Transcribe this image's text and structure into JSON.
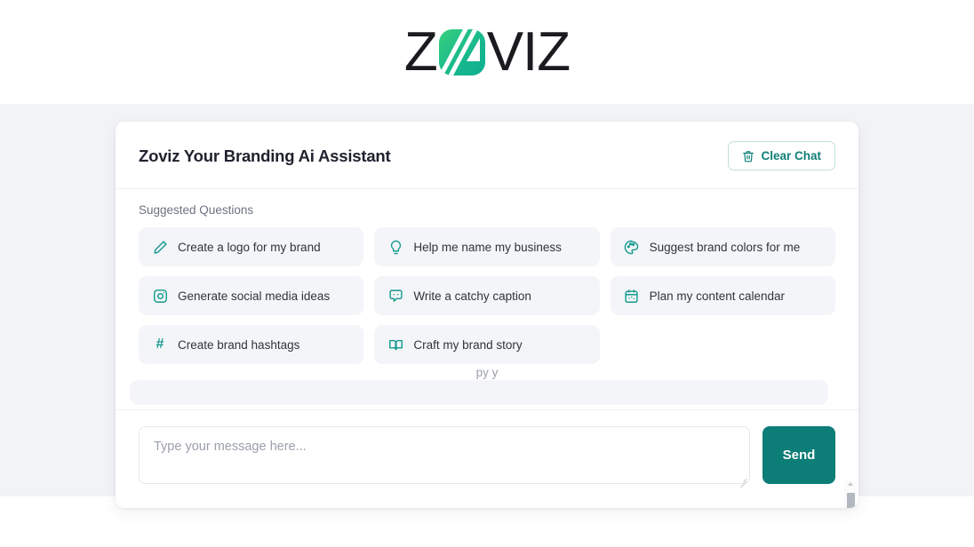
{
  "brand": {
    "name_part1": "Z",
    "name_part2": "VI",
    "name_part3": "Z",
    "logo_icon": "zoviz-logo-mark",
    "accent_green": "#18b98c",
    "teal": "#0d7d77",
    "page_background": "#f2f3f7"
  },
  "card": {
    "title": "Zoviz Your Branding Ai Assistant",
    "clear_chat": {
      "label": "Clear Chat",
      "icon": "trash-icon"
    }
  },
  "suggestions": {
    "label": "Suggested Questions",
    "items": [
      {
        "label": "Create a logo for my brand",
        "icon": "pen-icon"
      },
      {
        "label": "Help me name my business",
        "icon": "lightbulb-icon"
      },
      {
        "label": "Suggest brand colors for me",
        "icon": "palette-icon"
      },
      {
        "label": "Generate social media ideas",
        "icon": "instagram-icon"
      },
      {
        "label": "Write a catchy caption",
        "icon": "speech-bubble-icon"
      },
      {
        "label": "Plan my content calendar",
        "icon": "calendar-icon"
      },
      {
        "label": "Create brand hashtags",
        "icon": "hash-icon"
      },
      {
        "label": "Craft my brand story",
        "icon": "book-icon"
      }
    ]
  },
  "chat": {
    "partial_message": "py   y"
  },
  "composer": {
    "placeholder": "Type your message here...",
    "value": "",
    "send_label": "Send"
  }
}
